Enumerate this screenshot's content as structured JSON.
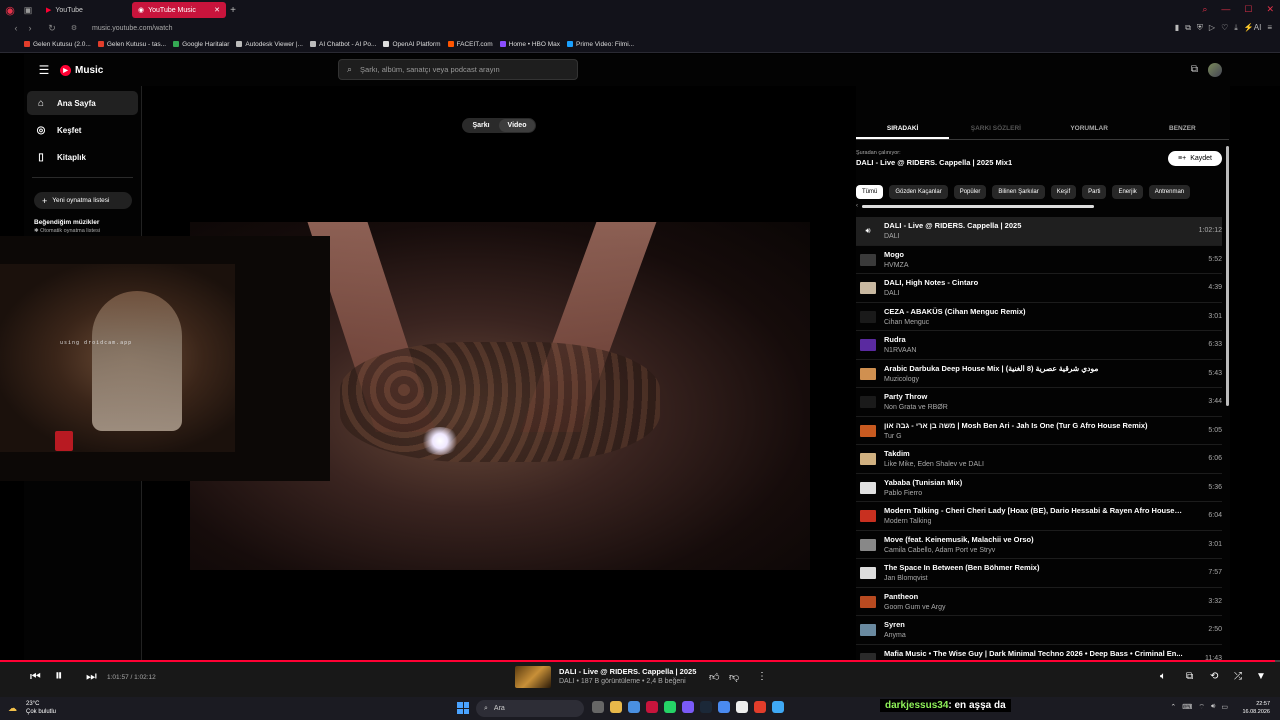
{
  "browser": {
    "tabs": [
      {
        "label": "YouTube",
        "active": false
      },
      {
        "label": "YouTube Music",
        "active": true
      }
    ],
    "url": "music.youtube.com/watch",
    "bookmarks": [
      {
        "label": "Gelen Kutusu (2.0...",
        "color": "#e23d2b"
      },
      {
        "label": "Gelen Kutusu - tas...",
        "color": "#e23d2b"
      },
      {
        "label": "Google Haritalar",
        "color": "#34a853"
      },
      {
        "label": "Autodesk Viewer |...",
        "color": "#bbbbbb"
      },
      {
        "label": "AI Chatbot - AI Po...",
        "color": "#bbbbbb"
      },
      {
        "label": "OpenAI Platform",
        "color": "#dddddd"
      },
      {
        "label": "FACEIT.com",
        "color": "#ff5500"
      },
      {
        "label": "Home • HBO Max",
        "color": "#8a4dff"
      },
      {
        "label": "Prime Video: Filmi...",
        "color": "#1aa0ff"
      }
    ]
  },
  "header": {
    "brand": "Music",
    "search_placeholder": "Şarkı, albüm, sanatçı veya podcast arayın"
  },
  "sidebar": {
    "items": [
      {
        "label": "Ana Sayfa",
        "icon": "home-icon"
      },
      {
        "label": "Keşfet",
        "icon": "compass-icon"
      },
      {
        "label": "Kitaplık",
        "icon": "library-icon"
      }
    ],
    "new_playlist": "Yeni oynatma listesi",
    "liked_title": "Beğendiğim müzikler",
    "liked_sub": "Otomatik oynatma listesi"
  },
  "main": {
    "toggle_song": "Şarkı",
    "toggle_video": "Video",
    "webcam_label": "using droidcam.app"
  },
  "queue_panel": {
    "tabs": [
      "SIRADAKİ",
      "ŞARKI SÖZLERİ",
      "YORUMLAR",
      "BENZER"
    ],
    "playing_from_label": "Şuradan çalınıyor:",
    "playing_from_title": "DALI - Live @ RIDERS. Cappella | 2025 Mix1",
    "save_label": "Kaydet",
    "chips": [
      "Tümü",
      "Gözden Kaçanlar",
      "Popüler",
      "Bilinen Şarkılar",
      "Keşif",
      "Parti",
      "Enerjik",
      "Antrenman"
    ],
    "items": [
      {
        "title": "DALI - Live @ RIDERS. Cappella | 2025",
        "artist": "DALI",
        "duration": "1:02:12",
        "playing": true,
        "thumb": "#333333"
      },
      {
        "title": "Mogo",
        "artist": "HVMZA",
        "duration": "5:52",
        "thumb": "#3a3a3a"
      },
      {
        "title": "DALI, High Notes - Cintaro",
        "artist": "DALI",
        "duration": "4:39",
        "thumb": "#c8b8a0"
      },
      {
        "title": "CEZA - ABAKÜS (Cihan Menguc Remix)",
        "artist": "Cihan Menguc",
        "duration": "3:01",
        "thumb": "#1a1a1a"
      },
      {
        "title": "Rudra",
        "artist": "N1RVAAN",
        "duration": "6:33",
        "thumb": "#5a2aa0"
      },
      {
        "title": "Arabic Darbuka Deep House Mix | مودي شرقية عصرية (8 الغنية)",
        "artist": "Muzicology",
        "duration": "5:43",
        "thumb": "#d09050"
      },
      {
        "title": "Party Throw",
        "artist": "Non Grata ve RBØR",
        "duration": "3:44",
        "thumb": "#1a1a1a"
      },
      {
        "title": "משה בן ארי - גבה און | Mosh Ben Ari - Jah Is One (Tur G Afro House Remix)",
        "artist": "Tur G",
        "duration": "5:05",
        "thumb": "#c85a20"
      },
      {
        "title": "Takdim",
        "artist": "Like Mike, Eden Shalev ve DALI",
        "duration": "6:06",
        "thumb": "#d0b080"
      },
      {
        "title": "Yababa (Tunisian Mix)",
        "artist": "Pablo Fierro",
        "duration": "5:36",
        "thumb": "#e0e0e0"
      },
      {
        "title": "Modern Talking - Cheri Cheri Lady [Hoax (BE), Dario Hessabi & Rayen Afro House Re...",
        "artist": "Modern Talking",
        "duration": "6:04",
        "thumb": "#c83020"
      },
      {
        "title": "Move (feat. Keinemusik, Malachii ve Orso)",
        "artist": "Camila Cabello, Adam Port ve Stryv",
        "duration": "3:01",
        "thumb": "#888888"
      },
      {
        "title": "The Space In Between (Ben Böhmer Remix)",
        "artist": "Jan Blomqvist",
        "duration": "7:57",
        "thumb": "#dddddd"
      },
      {
        "title": "Pantheon",
        "artist": "Goom Gum ve Argy",
        "duration": "3:32",
        "thumb": "#b84a20"
      },
      {
        "title": "Syren",
        "artist": "Anyma",
        "duration": "2:50",
        "thumb": "#6a8aa0"
      },
      {
        "title": "Mafia Music • The Wise Guy | Dark Minimal Techno 2026 • Deep Bass • Criminal En...",
        "artist": "",
        "duration": "11:43",
        "thumb": "#2a2a2a"
      }
    ]
  },
  "player": {
    "time": "1:01:57 / 1:02:12",
    "progress_fraction": 0.996,
    "title": "DALI - Live @ RIDERS. Cappella | 2025",
    "meta": "DALI • 187 B görüntüleme • 2,4 B beğeni",
    "accent": "#ff0033"
  },
  "taskbar": {
    "weather_temp": "23°C",
    "weather_desc": "Çok bulutlu",
    "search_label": "Ara",
    "clock_time": "22:57",
    "clock_date": "16.08.2026"
  },
  "stream_chat": {
    "user": "darkjessus34",
    "message": ": en aşşa da"
  }
}
